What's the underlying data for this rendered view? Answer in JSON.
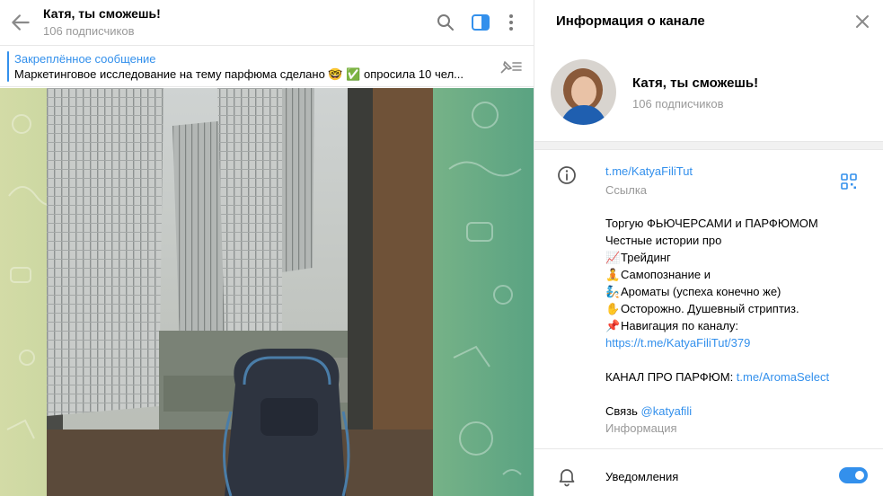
{
  "chat": {
    "title": "Катя, ты сможешь!",
    "subscribers": "106 подписчиков"
  },
  "pinned": {
    "title": "Закреплённое сообщение",
    "text": "Маркетинговое исследование на тему парфюма сделано 🤓 ✅ опросила 10 чел..."
  },
  "info": {
    "title": "Информация о канале",
    "channel_name": "Катя, ты сможешь!",
    "subscribers": "106 подписчиков",
    "link": "t.me/KatyaFiliTut",
    "link_label": "Ссылка",
    "description": {
      "l1": "Торгую ФЬЮЧЕРСАМИ и ПАРФЮМОМ",
      "l2": "Честные истории про",
      "l3_emoji": "📈",
      "l3": "Трейдинг",
      "l4_emoji": "🧘",
      "l4": "Самопознание и",
      "l5_emoji": "🧞",
      "l5": "Ароматы (успеха конечно же)",
      "l6_emoji": "✋",
      "l6": "Осторожно. Душевный стриптиз.",
      "l7_emoji": "📌",
      "l7": "Навигация по каналу:",
      "l8": "https://t.me/KatyaFiliTut/379",
      "l9_prefix": "КАНАЛ ПРО ПАРФЮМ: ",
      "l9_link": "t.me/AromaSelect",
      "l10_prefix": "Связь ",
      "l10_link": "@katyafili"
    },
    "description_label": "Информация",
    "notifications_label": "Уведомления",
    "notifications_on": true
  },
  "icons": {
    "back": "arrow-left-icon",
    "search": "search-icon",
    "sidebar": "sidebar-toggle-icon",
    "menu": "more-vertical-icon",
    "unpin": "unpin-icon",
    "close": "close-icon",
    "info": "info-icon",
    "qr": "qr-code-icon",
    "bell": "bell-icon"
  },
  "colors": {
    "accent": "#3390ec",
    "muted": "#999999"
  }
}
